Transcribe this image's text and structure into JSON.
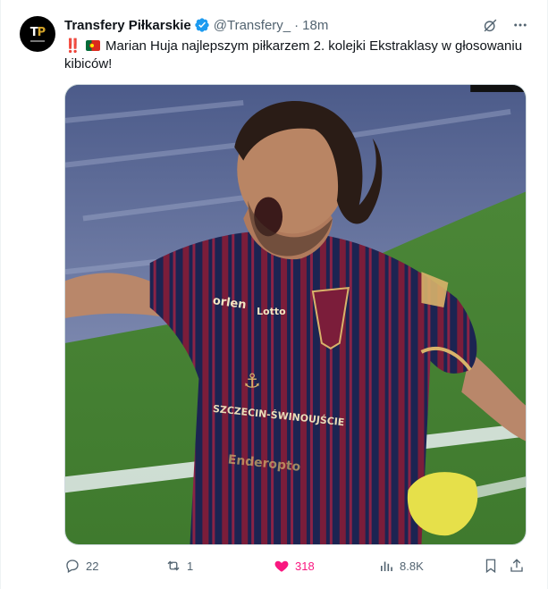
{
  "tweet": {
    "display_name": "Transfery Piłkarskie",
    "handle": "@Transfery_",
    "separator": "·",
    "time": "18m",
    "avatar_text": "TP",
    "text_emoji": "‼️",
    "text": "Marian Huja najlepszym piłkarzem 2. kolejki Ekstraklasy w głosowaniu kibiców!"
  },
  "media": {
    "sponsor_text": "SZCZECIN-ŚWINOUJŚCIE",
    "shirt_brand": "Lotto",
    "shirt_sponsor": "orlen",
    "shirt_bottom": "Enderopto"
  },
  "actions": {
    "replies": "22",
    "reposts": "1",
    "likes": "318",
    "views": "8.8K"
  },
  "colors": {
    "like": "#f91880",
    "verified": "#1d9bf0",
    "muted": "#536471"
  },
  "icons": [
    "verified-badge-icon",
    "grok-icon",
    "more-icon",
    "reply-icon",
    "repost-icon",
    "like-icon",
    "views-icon",
    "bookmark-icon",
    "share-icon"
  ]
}
